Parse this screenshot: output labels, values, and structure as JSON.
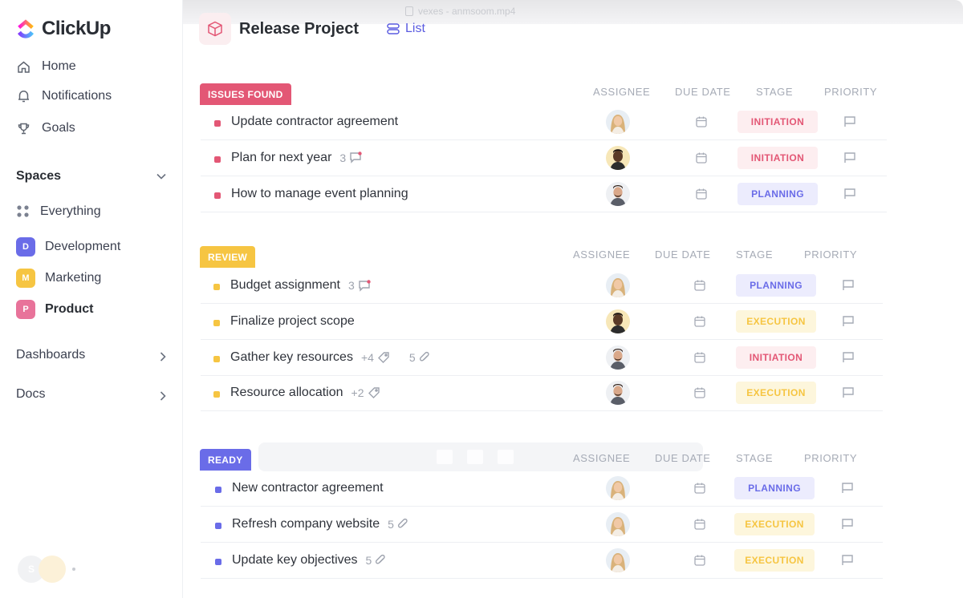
{
  "video": {
    "filename": "vexes - anmsoom.mp4"
  },
  "sidebar": {
    "logo": "ClickUp",
    "nav": [
      {
        "label": "Home",
        "icon": "home-icon"
      },
      {
        "label": "Notifications",
        "icon": "bell-icon"
      },
      {
        "label": "Goals",
        "icon": "trophy-icon"
      }
    ],
    "spaces_header": "Spaces",
    "everything": "Everything",
    "spaces": [
      {
        "letter": "D",
        "label": "Development",
        "color": "#6a6ce8"
      },
      {
        "letter": "M",
        "label": "Marketing",
        "color": "#f6c542"
      },
      {
        "letter": "P",
        "label": "Product",
        "color": "#e8739a"
      }
    ],
    "dashboards": "Dashboards",
    "docs": "Docs",
    "user_initial": "S"
  },
  "header": {
    "title": "Release Project",
    "view": "List"
  },
  "columns": {
    "assignee": "ASSIGNEE",
    "due": "DUE DATE",
    "stage": "STAGE",
    "priority": "PRIORITY"
  },
  "groups": [
    {
      "label": "ISSUES FOUND",
      "color": "#e35775",
      "tasks": [
        {
          "name": "Update contractor agreement",
          "meta": "",
          "meta2": "",
          "assignee": "woman-blonde",
          "stage": "INITIATION"
        },
        {
          "name": "Plan for next year",
          "meta": "3",
          "meta_icon": "comment",
          "meta2": "",
          "assignee": "man-dark",
          "stage": "INITIATION"
        },
        {
          "name": "How to manage event planning",
          "meta": "",
          "meta2": "",
          "assignee": "man-beard",
          "stage": "PLANNING"
        }
      ]
    },
    {
      "label": "REVIEW",
      "color": "#f6c542",
      "tasks": [
        {
          "name": "Budget assignment",
          "meta": "3",
          "meta_icon": "comment",
          "meta2": "",
          "assignee": "woman-blonde",
          "stage": "PLANNING"
        },
        {
          "name": "Finalize project scope",
          "meta": "",
          "meta2": "",
          "assignee": "man-dark",
          "stage": "EXECUTION"
        },
        {
          "name": "Gather key resources",
          "meta": "+4",
          "meta_icon": "tag",
          "meta2": "5",
          "meta2_icon": "clip",
          "assignee": "man-beard",
          "stage": "INITIATION"
        },
        {
          "name": "Resource allocation",
          "meta": "+2",
          "meta_icon": "tag",
          "meta2": "",
          "assignee": "man-beard",
          "stage": "EXECUTION"
        }
      ]
    },
    {
      "label": "READY",
      "color": "#6a6ce8",
      "tasks": [
        {
          "name": "New contractor agreement",
          "meta": "",
          "meta2": "",
          "assignee": "woman-blonde",
          "stage": "PLANNING"
        },
        {
          "name": "Refresh company website",
          "meta": "5",
          "meta_icon": "clip",
          "meta2": "",
          "assignee": "woman-blonde",
          "stage": "EXECUTION"
        },
        {
          "name": "Update key objectives",
          "meta": "5",
          "meta_icon": "clip",
          "meta2": "",
          "assignee": "woman-blonde",
          "stage": "EXECUTION"
        }
      ]
    }
  ]
}
